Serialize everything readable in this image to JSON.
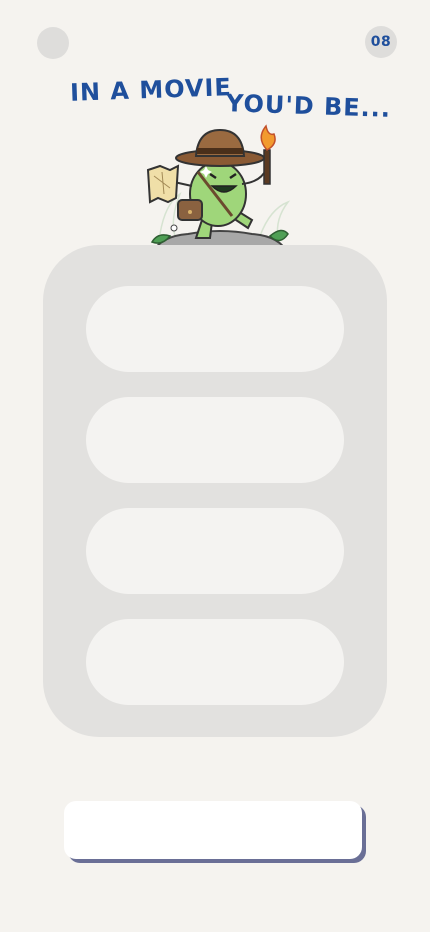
{
  "header": {
    "step": "08",
    "back_icon": "back-icon"
  },
  "question": {
    "line1": "IN A MOVIE",
    "line2": "YOU'D BE..."
  },
  "options": [
    "",
    "",
    "",
    ""
  ],
  "submit": {
    "label": ""
  },
  "colors": {
    "background": "#f5f3ef",
    "accent": "#1f4f9c",
    "panel": "#e2e1df",
    "option": "#f4f3f1",
    "button_shadow": "#6a6f96"
  }
}
